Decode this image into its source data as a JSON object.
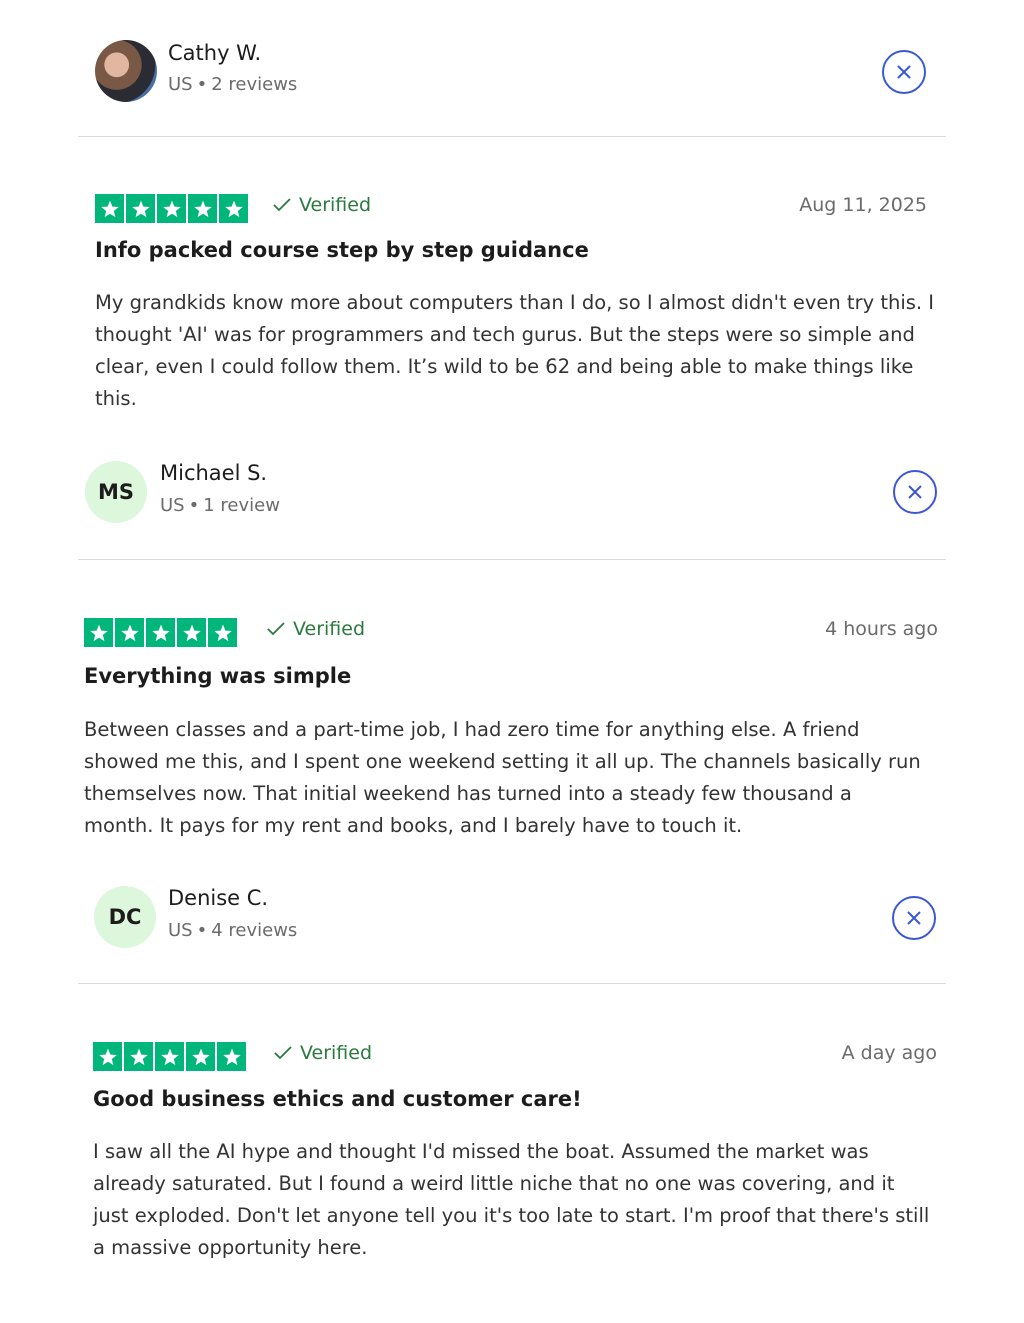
{
  "reviewers": [
    {
      "name": "Cathy W.",
      "country": "US",
      "reviews": "2 reviews",
      "avatar": "photo"
    },
    {
      "name": "Michael S.",
      "country": "US",
      "reviews": "1 review",
      "initials": "MS"
    },
    {
      "name": "Denise C.",
      "country": "US",
      "reviews": "4 reviews",
      "initials": "DC"
    }
  ],
  "reviews": [
    {
      "rating": 5,
      "verified": "Verified",
      "date": "Aug 11, 2025",
      "title": "Info packed course step by step guidance",
      "body": "My grandkids know more about computers than I do, so I almost didn't even try this. I thought 'AI' was for programmers and tech gurus. But the steps were so simple and clear, even I could follow them. It’s wild to be 62 and being able to make things like this."
    },
    {
      "rating": 5,
      "verified": "Verified",
      "date": "4 hours ago",
      "title": "Everything was simple",
      "body": "Between classes and a part-time job, I had zero time for anything else. A friend showed me this, and I spent one weekend setting it all up. The channels basically run themselves now. That initial weekend has turned into a steady few thousand a month. It pays for my rent and books, and I barely have to touch it."
    },
    {
      "rating": 5,
      "verified": "Verified",
      "date": "A day ago",
      "title": "Good business ethics and customer care!",
      "body": "I saw all the AI hype and thought I'd missed the boat. Assumed the market was already saturated. But I found a weird little niche that no one was covering, and it just exploded. Don't let anyone tell you it's too late to start. I'm proof that there's still a massive opportunity here."
    }
  ],
  "icons": {
    "star": "star-icon",
    "check": "check-icon",
    "close": "close-icon"
  },
  "colors": {
    "star_bg": "#00b67a",
    "verified": "#2a7a3e",
    "close": "#3c57d6",
    "initials_bg": "#dcf7dc"
  }
}
